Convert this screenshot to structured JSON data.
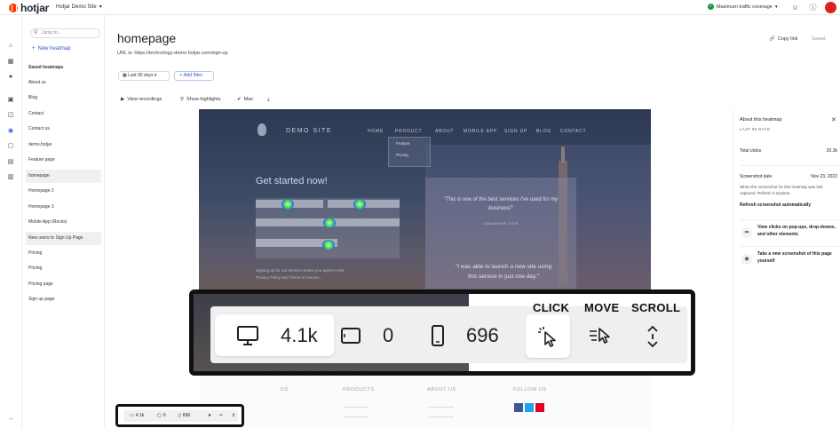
{
  "topbar": {
    "logo": "hotjar",
    "site_name": "Hotjar Demo Site",
    "traffic_coverage": "Maximum traffic coverage"
  },
  "sidebar": {
    "search_placeholder": "Jump to...",
    "new_heatmap": "New heatmap",
    "saved_title": "Saved heatmaps",
    "items": [
      {
        "label": "About us"
      },
      {
        "label": "Blog"
      },
      {
        "label": "Contact"
      },
      {
        "label": "Contact us"
      },
      {
        "label": "demo.hotjar"
      },
      {
        "label": "Feature page"
      },
      {
        "label": "homepage"
      },
      {
        "label": "Homepage 2"
      },
      {
        "label": "Homepage 3"
      },
      {
        "label": "Mobile App (Rocks)"
      },
      {
        "label": "New users to Sign Up Page"
      },
      {
        "label": "Pricing"
      },
      {
        "label": "Pricing"
      },
      {
        "label": "Pricing page"
      },
      {
        "label": "Sign up page"
      }
    ]
  },
  "header": {
    "title": "homepage",
    "url_line": "URL is: https://technology-demo.hotjar.com/sign-up",
    "copy_link": "Copy link",
    "saved": "Saved",
    "date_range": "Last 90 days",
    "add_filter": "Add filter"
  },
  "toolbar": {
    "view_recordings": "View recordings",
    "show_highlights": "Show highlights",
    "max": "Max"
  },
  "site_preview": {
    "logo": "DEMO SITE",
    "nav": [
      "HOME",
      "PRODUCT",
      "ABOUT",
      "MOBILE APP",
      "SIGN UP",
      "BLOG",
      "CONTACT"
    ],
    "dropdown": [
      "Feature",
      "Pricing"
    ],
    "hero_title": "Get started now!",
    "quote": "\"This is one of the best services I've used for my business!\"",
    "quote_author": "JONATHAN DOE",
    "quote2": "\"I was able to launch a new site using this service in just one day.\"",
    "terms_line1": "Signing up for our service means you agree to the",
    "terms_line2": "Privacy Policy and Terms of Service.",
    "footer_cols": [
      "DS",
      "PRODUCTS",
      "ABOUT US",
      "FOLLOW US"
    ],
    "footer_links": [
      "Features",
      "Pricing",
      "Company",
      "Blog"
    ]
  },
  "right_panel": {
    "title": "About this heatmap",
    "subtitle": "LAST 90 DAYS",
    "total_clicks_label": "Total clicks",
    "total_clicks_value": "20.3k",
    "screenshot_date_label": "Screenshot date",
    "screenshot_date_value": "Nov 23, 2022",
    "note": "When the screenshot for this heatmap was last captured. Refresh it anytime.",
    "refresh": "Refresh screenshot automatically",
    "tip1": "View clicks on pop-ups, drop-downs, and other elements",
    "tip2": "Take a new screenshot of this page yourself"
  },
  "callout": {
    "desktop_count": "4.1k",
    "tablet_count": "0",
    "mobile_count": "696",
    "click": "CLICK",
    "move": "MOVE",
    "scroll": "SCROLL"
  },
  "mini_toolbar": {
    "desktop_count": "4.1k",
    "tablet_count": "0",
    "mobile_count": "696"
  },
  "colors": {
    "brand": "#ff3c00",
    "accent": "#2e56d8",
    "callout_border": "#111111"
  }
}
